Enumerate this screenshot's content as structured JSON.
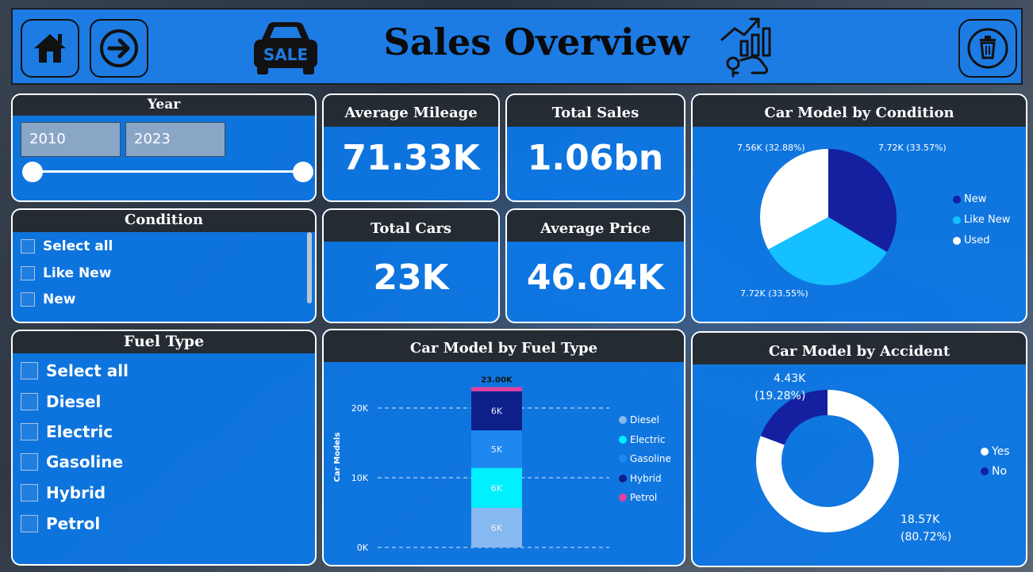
{
  "header": {
    "title": "Sales Overview",
    "sale_badge": "SALE"
  },
  "year_slicer": {
    "title": "Year",
    "start": "2010",
    "end": "2023"
  },
  "condition_slicer": {
    "title": "Condition",
    "items": [
      "Select all",
      "Like New",
      "New"
    ]
  },
  "fuel_slicer": {
    "title": "Fuel Type",
    "items": [
      "Select all",
      "Diesel",
      "Electric",
      "Gasoline",
      "Hybrid",
      "Petrol"
    ]
  },
  "kpis": {
    "avg_mileage": {
      "label": "Average Mileage",
      "value": "71.33K"
    },
    "total_sales": {
      "label": "Total Sales",
      "value": "1.06bn"
    },
    "total_cars": {
      "label": "Total Cars",
      "value": "23K"
    },
    "avg_price": {
      "label": "Average Price",
      "value": "46.04K"
    }
  },
  "colors": {
    "new": "#1420a0",
    "like_new": "#14c0ff",
    "used": "#ffffff",
    "diesel": "#86b9f0",
    "electric": "#00f0ff",
    "gasoline": "#1e88f0",
    "hybrid": "#0e1f8a",
    "petrol": "#e040a0"
  },
  "chart_data": [
    {
      "type": "pie",
      "title": "Car Model by Condition",
      "labels": [
        "New",
        "Like New",
        "Used"
      ],
      "values": [
        7.72,
        7.72,
        7.56
      ],
      "data_labels": [
        "7.72K (33.57%)",
        "7.72K (33.55%)",
        "7.56K (32.88%)"
      ],
      "legend": "right"
    },
    {
      "type": "bar",
      "stacked": true,
      "title": "Car Model by Fuel Type",
      "ylabel": "Car Models",
      "yticks": [
        "0K",
        "10K",
        "20K"
      ],
      "ylim": [
        0,
        23000
      ],
      "total_label": "23.00K",
      "categories": [
        ""
      ],
      "series": [
        {
          "name": "Diesel",
          "values": [
            5700
          ],
          "label": "6K"
        },
        {
          "name": "Electric",
          "values": [
            5700
          ],
          "label": "6K"
        },
        {
          "name": "Gasoline",
          "values": [
            5400
          ],
          "label": "5K"
        },
        {
          "name": "Hybrid",
          "values": [
            5600
          ],
          "label": "6K"
        },
        {
          "name": "Petrol",
          "values": [
            600
          ],
          "label": ""
        }
      ],
      "legend": "right"
    },
    {
      "type": "pie",
      "donut": true,
      "title": "Car Model by Accident",
      "labels": [
        "Yes",
        "No"
      ],
      "values": [
        18.57,
        4.43
      ],
      "data_labels": [
        "18.57K",
        "(80.72%)",
        "4.43K",
        "(19.28%)"
      ],
      "legend": "right"
    }
  ]
}
